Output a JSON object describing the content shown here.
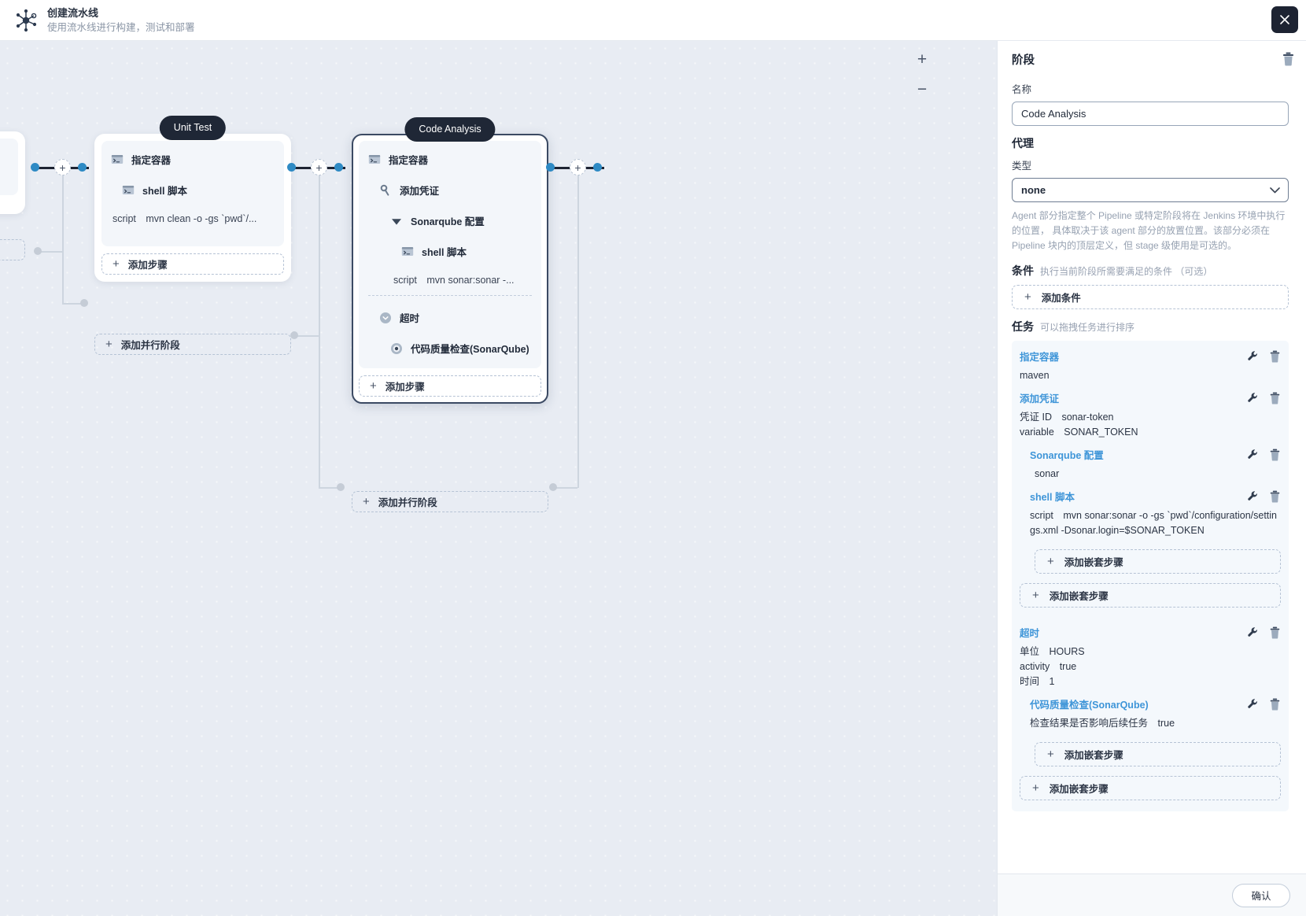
{
  "header": {
    "title": "创建流水线",
    "subtitle": "使用流水线进行构建，测试和部署",
    "logo_icon": "pipeline-node-icon",
    "close_icon": "close-icon"
  },
  "canvas": {
    "zoom_in": "+",
    "zoom_out": "−",
    "connector_plus": "+",
    "stages": [
      {
        "name": "Unit Test",
        "add_step_label": "添加步骤",
        "add_parallel_label": "添加并行阶段",
        "selected": false,
        "steps": [
          {
            "icon": "terminal-icon",
            "label": "指定容器",
            "indent": 0
          },
          {
            "icon": "terminal-icon",
            "label": "shell 脚本",
            "indent": 1
          }
        ],
        "kvs": [
          {
            "key": "script",
            "value": "mvn clean -o -gs `pwd`/..."
          }
        ]
      },
      {
        "name": "Code Analysis",
        "add_step_label": "添加步骤",
        "add_parallel_label": "添加并行阶段",
        "selected": true,
        "steps": [
          {
            "icon": "terminal-icon",
            "label": "指定容器",
            "indent": 0
          },
          {
            "icon": "key-icon",
            "label": "添加凭证",
            "indent": 1
          },
          {
            "icon": "sonarqube-icon",
            "label": "Sonarqube 配置",
            "indent": 2
          },
          {
            "icon": "terminal-icon",
            "label": "shell 脚本",
            "indent": 3
          }
        ],
        "kvs": [
          {
            "key": "script",
            "value": "mvn sonar:sonar -..."
          }
        ],
        "steps2": [
          {
            "icon": "clock-icon",
            "label": "超时",
            "indent": 0
          },
          {
            "icon": "target-icon",
            "label": "代码质量检查(SonarQube)",
            "indent": 1
          }
        ]
      }
    ]
  },
  "panel": {
    "title": "阶段",
    "delete_icon": "trash-icon",
    "name_label": "名称",
    "name_value": "Code Analysis",
    "agent_section": "代理",
    "type_label": "类型",
    "type_value": "none",
    "type_chevron": "chevron-down-icon",
    "agent_help": "Agent 部分指定整个 Pipeline 或特定阶段将在 Jenkins 环境中执行的位置， 具体取决于该 agent 部分的放置位置。该部分必须在 Pipeline 块内的顶层定义，但 stage 级使用是可选的。",
    "condition_title": "条件",
    "condition_hint": "执行当前阶段所需要满足的条件 （可选）",
    "add_condition_label": "添加条件",
    "tasks_title": "任务",
    "tasks_hint": "可以拖拽任务进行排序",
    "add_nested_label": "添加嵌套步骤",
    "edit_icon": "wrench-icon",
    "trash_icon": "trash-icon",
    "tasks": [
      {
        "name": "指定容器",
        "indent": 0,
        "kvs": [
          {
            "key": "maven",
            "value": ""
          }
        ]
      },
      {
        "name": "添加凭证",
        "indent": 0,
        "kvs": [
          {
            "key": "凭证 ID",
            "value": "sonar-token"
          },
          {
            "key": "variable",
            "value": "SONAR_TOKEN"
          }
        ]
      },
      {
        "name": "Sonarqube 配置",
        "indent": 1,
        "kvs": [
          {
            "key": "sonar",
            "value": ""
          }
        ]
      },
      {
        "name": "shell 脚本",
        "indent": 1,
        "kvs": [
          {
            "key": "script",
            "value": "mvn sonar:sonar -o -gs `pwd`/configuration/settings.xml -Dsonar.login=$SONAR_TOKEN"
          }
        ]
      },
      {
        "name": "超时",
        "indent": 0,
        "kvs": [
          {
            "key": "单位",
            "value": "HOURS"
          },
          {
            "key": "activity",
            "value": "true"
          },
          {
            "key": "时间",
            "value": "1"
          }
        ]
      },
      {
        "name": "代码质量检查(SonarQube)",
        "indent": 1,
        "kvs": [
          {
            "key": "检查结果是否影响后续任务",
            "value": "true"
          }
        ]
      }
    ],
    "confirm_label": "确认"
  },
  "colors": {
    "accent_blue": "#3e95d8",
    "dark": "#1f2736",
    "canvas_bg": "#e8ecf3"
  }
}
